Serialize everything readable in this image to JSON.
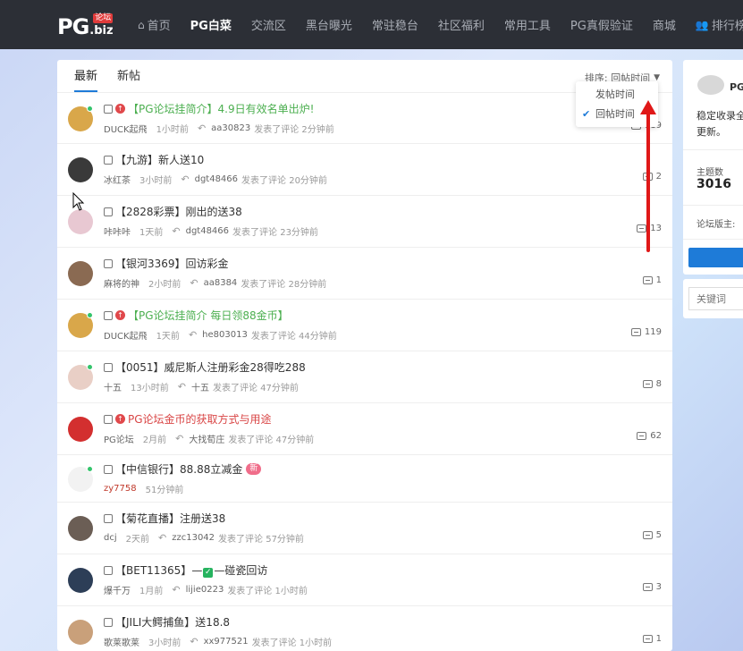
{
  "header": {
    "logo_text": "PG",
    "logo_tag": "论坛",
    "logo_sub": ".biz",
    "nav": [
      {
        "label": "首页",
        "icon": "home-icon",
        "glyph": "⌂"
      },
      {
        "label": "PG白菜",
        "active": true
      },
      {
        "label": "交流区"
      },
      {
        "label": "黑台曝光"
      },
      {
        "label": "常驻稳台"
      },
      {
        "label": "社区福利"
      },
      {
        "label": "常用工具"
      },
      {
        "label": "PG真假验证"
      },
      {
        "label": "商城"
      },
      {
        "label": "排行榜",
        "icon": "users-icon",
        "glyph": "👥"
      }
    ]
  },
  "tabs": [
    {
      "label": "最新",
      "active": true
    },
    {
      "label": "新帖"
    }
  ],
  "sort": {
    "label": "排序: 回帖时间"
  },
  "dropdown": {
    "options": [
      {
        "label": "发帖时间",
        "selected": false
      },
      {
        "label": "回帖时间",
        "selected": true
      }
    ]
  },
  "threads": [
    {
      "avatar_color": "#d9a74a",
      "online": true,
      "sticky": true,
      "title": "【PG论坛挂简介】4.9日有效名单出炉!",
      "title_style": "green",
      "author": "DUCK起飛",
      "time": "1小时前",
      "replier": "aa30823",
      "reply_text": "发表了评论 2分钟前",
      "comments": "119"
    },
    {
      "avatar_color": "#3a3a3a",
      "online": false,
      "sticky": false,
      "title": "【九游】新人送10",
      "title_style": "normal",
      "author": "冰红茶",
      "time": "3小时前",
      "replier": "dgt48466",
      "reply_text": "发表了评论 20分钟前",
      "comments": "2"
    },
    {
      "avatar_color": "#e8c8d2",
      "online": false,
      "sticky": false,
      "title": "【2828彩票】刚出的送38",
      "title_style": "normal",
      "author": "咔咔咔",
      "time": "1天前",
      "replier": "dgt48466",
      "reply_text": "发表了评论 23分钟前",
      "comments": "13"
    },
    {
      "avatar_color": "#8a6a52",
      "online": false,
      "sticky": false,
      "title": "【银河3369】回访彩金",
      "title_style": "normal",
      "author": "麻将的神",
      "time": "2小时前",
      "replier": "aa8384",
      "reply_text": "发表了评论 28分钟前",
      "comments": "1"
    },
    {
      "avatar_color": "#d9a74a",
      "online": true,
      "sticky": true,
      "title": "【PG论坛挂简介 每日领88金币】",
      "title_style": "green",
      "author": "DUCK起飛",
      "time": "1天前",
      "replier": "he803013",
      "reply_text": "发表了评论 44分钟前",
      "comments": "119"
    },
    {
      "avatar_color": "#e9cfc6",
      "online": true,
      "sticky": false,
      "title": "【0051】威尼斯人注册彩金28得吃288",
      "title_style": "normal",
      "author": "十五",
      "time": "13小时前",
      "replier": "十五",
      "reply_text": "发表了评论 47分钟前",
      "comments": "8"
    },
    {
      "avatar_color": "#d32f2f",
      "online": false,
      "sticky": true,
      "title": "PG论坛金币的获取方式与用途",
      "title_style": "red",
      "author": "PG论坛",
      "time": "2月前",
      "replier": "大找荀庄",
      "reply_text": "发表了评论 47分钟前",
      "comments": "62"
    },
    {
      "avatar_color": "#f2f2f2",
      "online": true,
      "sticky": false,
      "title": "【中信银行】88.88立减金",
      "title_style": "normal",
      "badge": "新",
      "author": "zy7758",
      "author_style": "red",
      "time": "51分钟前",
      "replier": "",
      "reply_text": "",
      "comments": ""
    },
    {
      "avatar_color": "#6b5e55",
      "online": false,
      "sticky": false,
      "title": "【菊花直播】注册送38",
      "title_style": "normal",
      "author": "dcj",
      "time": "2天前",
      "replier": "zzc13042",
      "reply_text": "发表了评论 57分钟前",
      "comments": "5"
    },
    {
      "avatar_color": "#2d3e57",
      "online": false,
      "sticky": false,
      "title_parts": [
        "【BET11365】—",
        "—碰瓷回访"
      ],
      "title_style": "normal",
      "author": "爆千万",
      "time": "1月前",
      "replier": "lijie0223",
      "reply_text": "发表了评论 1小时前",
      "comments": "3"
    },
    {
      "avatar_color": "#c9a07a",
      "online": false,
      "sticky": false,
      "title": "【JILI大鳄捕鱼】送18.8",
      "title_style": "normal",
      "author": "歌莱歌莱",
      "time": "3小时前",
      "replier": "xx977521",
      "reply_text": "发表了评论 1小时前",
      "comments": "1"
    }
  ],
  "sidebar": {
    "title": "PG",
    "desc": "稳定收录全更新。",
    "topics_label": "主题数",
    "topics_value": "3016",
    "moderator_label": "论坛版主:",
    "search_placeholder": "关键词"
  },
  "colors": {
    "topbar": "#2c2f36",
    "accent": "#1e7bd8",
    "annotation": "#e01818"
  }
}
